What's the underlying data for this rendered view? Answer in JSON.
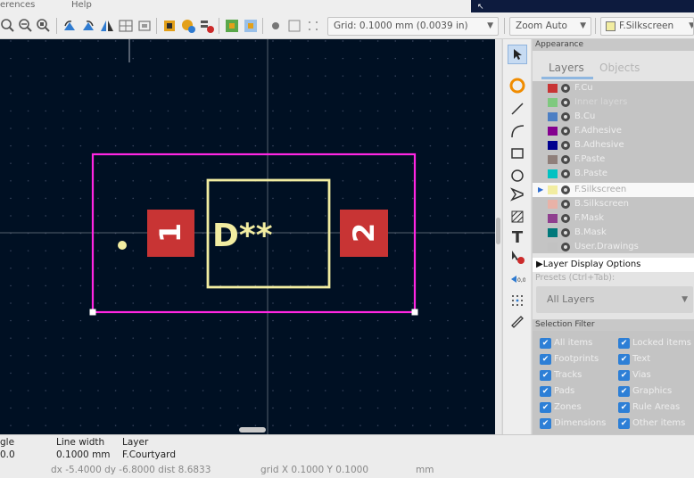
{
  "menubar": {
    "items": [
      "erences",
      "Help"
    ]
  },
  "toolbar": {
    "grid_label": "Grid: 0.1000 mm (0.0039 in)",
    "zoom_label": "Zoom Auto",
    "layer_label": "F.Silkscreen"
  },
  "canvas": {
    "reference": "D**",
    "pad1": "1",
    "pad2": "2"
  },
  "appearance": {
    "title": "Appearance",
    "tabs": [
      "Layers",
      "Objects"
    ],
    "layers": [
      {
        "name": "F.Cu",
        "color": "#c83434"
      },
      {
        "name": "Inner layers",
        "color": "#7fc97f"
      },
      {
        "name": "B.Cu",
        "color": "#4d7fc4"
      },
      {
        "name": "F.Adhesive",
        "color": "#84008f"
      },
      {
        "name": "B.Adhesive",
        "color": "#00008f"
      },
      {
        "name": "F.Paste",
        "color": "#8f7f7a"
      },
      {
        "name": "B.Paste",
        "color": "#00c2c2"
      },
      {
        "name": "F.Silkscreen",
        "color": "#f2eda1"
      },
      {
        "name": "B.Silkscreen",
        "color": "#e8b2a7"
      },
      {
        "name": "F.Mask",
        "color": "#8f3f8f"
      },
      {
        "name": "B.Mask",
        "color": "#00787a"
      },
      {
        "name": "User.Drawings",
        "color": "#c2c2c2"
      }
    ],
    "layer_display_options": "Layer Display Options",
    "presets_label": "Presets (Ctrl+Tab):",
    "presets_value": "All Layers"
  },
  "selection_filter": {
    "title": "Selection Filter",
    "items": [
      "All items",
      "Locked items",
      "Footprints",
      "Text",
      "Tracks",
      "Vias",
      "Pads",
      "Graphics",
      "Zones",
      "Rule Areas",
      "Dimensions",
      "Other items"
    ]
  },
  "status": {
    "angle_hdr": "gle",
    "angle_val": "0.0",
    "linewidth_hdr": "Line width",
    "linewidth_val": "0.1000 mm",
    "layer_hdr": "Layer",
    "layer_val": "F.Courtyard",
    "delta": "dx -5.4000  dy -6.8000  dist 8.6833",
    "grid": "grid X 0.1000  Y 0.1000",
    "units": "mm"
  }
}
